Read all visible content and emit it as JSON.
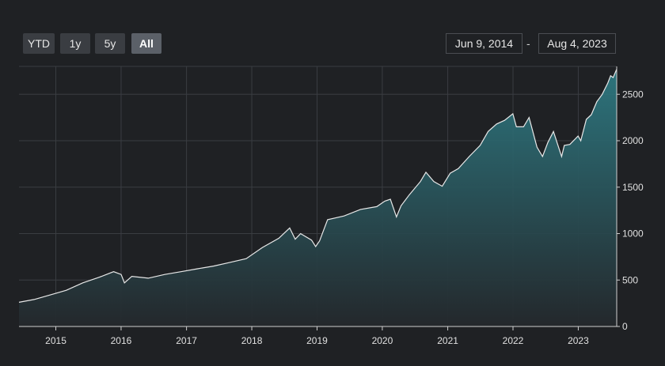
{
  "range_selector": {
    "buttons": [
      {
        "label": "YTD",
        "active": false
      },
      {
        "label": "1y",
        "active": false
      },
      {
        "label": "5y",
        "active": false
      },
      {
        "label": "All",
        "active": true
      }
    ]
  },
  "date_range": {
    "from": "Jun 9, 2014",
    "separator": "-",
    "to": "Aug 4, 2023"
  },
  "colors": {
    "background": "#1f2124",
    "grid": "#3a3d42",
    "line": "#e8e8e8",
    "area_top": "#2e7d86",
    "area_bottom": "#24282c"
  },
  "chart_data": {
    "type": "area",
    "title": "",
    "xlabel": "",
    "ylabel": "",
    "ylim": [
      0,
      2800
    ],
    "xlim": [
      "2014-06-09",
      "2023-08-04"
    ],
    "y_axis_position": "right",
    "grid": true,
    "x_ticks": [
      "2015",
      "2016",
      "2017",
      "2018",
      "2019",
      "2020",
      "2021",
      "2022",
      "2023"
    ],
    "y_ticks": [
      0,
      500,
      1000,
      1500,
      2000,
      2500
    ],
    "series": [
      {
        "x": [
          "2014-06-09",
          "2014-09-01",
          "2014-12-01",
          "2015-03-01",
          "2015-06-01",
          "2015-09-01",
          "2015-11-20",
          "2016-01-01",
          "2016-01-20",
          "2016-03-01",
          "2016-06-01",
          "2016-09-01",
          "2016-12-01",
          "2017-03-01",
          "2017-06-01",
          "2017-09-01",
          "2017-12-01",
          "2018-03-01",
          "2018-06-01",
          "2018-08-01",
          "2018-09-01",
          "2018-10-01",
          "2018-12-01",
          "2018-12-24",
          "2019-01-15",
          "2019-03-01",
          "2019-06-01",
          "2019-09-01",
          "2019-12-01",
          "2020-01-15",
          "2020-02-15",
          "2020-03-20",
          "2020-04-15",
          "2020-06-01",
          "2020-08-01",
          "2020-09-01",
          "2020-10-15",
          "2020-12-01",
          "2021-01-15",
          "2021-03-01",
          "2021-05-01",
          "2021-07-01",
          "2021-08-15",
          "2021-10-01",
          "2021-11-15",
          "2021-12-31",
          "2022-01-20",
          "2022-03-01",
          "2022-04-01",
          "2022-05-15",
          "2022-06-15",
          "2022-07-15",
          "2022-08-15",
          "2022-09-30",
          "2022-10-15",
          "2022-11-15",
          "2022-12-31",
          "2023-01-15",
          "2023-02-15",
          "2023-03-15",
          "2023-04-15",
          "2023-05-15",
          "2023-06-15",
          "2023-07-01",
          "2023-07-15",
          "2023-08-04"
        ],
        "y": [
          260,
          290,
          340,
          390,
          470,
          530,
          590,
          560,
          470,
          540,
          520,
          560,
          590,
          620,
          650,
          690,
          730,
          850,
          950,
          1060,
          940,
          1000,
          930,
          860,
          920,
          1150,
          1190,
          1260,
          1290,
          1350,
          1370,
          1180,
          1300,
          1420,
          1560,
          1660,
          1560,
          1510,
          1650,
          1700,
          1830,
          1950,
          2100,
          2180,
          2220,
          2290,
          2150,
          2150,
          2250,
          1930,
          1830,
          1980,
          2100,
          1830,
          1950,
          1960,
          2050,
          2000,
          2230,
          2280,
          2420,
          2500,
          2620,
          2700,
          2680,
          2770
        ]
      }
    ]
  }
}
